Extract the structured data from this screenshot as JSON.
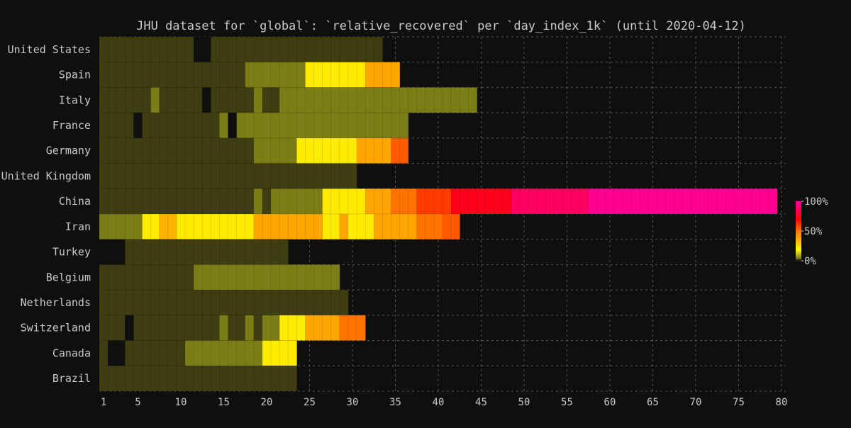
{
  "chart_data": {
    "type": "heatmap",
    "title": "JHU dataset for `global`: `relative_recovered` per `day_index_1k` (until 2020-04-12)",
    "xlabel": "",
    "ylabel": "",
    "xlim": [
      1,
      80
    ],
    "x_ticks": [
      1,
      5,
      10,
      15,
      20,
      25,
      30,
      35,
      40,
      45,
      50,
      55,
      60,
      65,
      70,
      75,
      80
    ],
    "grid": true,
    "colorbar": {
      "ticks": [
        "100%",
        "50%",
        "0%"
      ],
      "stops": [
        "#3a3a12",
        "#6e6e16",
        "#9a9a1a",
        "#ffff00",
        "#ffc400",
        "#ff9900",
        "#ff5a00",
        "#ff0000",
        "#ff00a0"
      ]
    },
    "note": "Rows list countries; each row gives [start_day, end_day, relative_recovered_percent] runs estimated from cell colors.",
    "rows": [
      {
        "name": "United States",
        "segments": [
          [
            1,
            11,
            0.3
          ],
          [
            12,
            13,
            0
          ],
          [
            14,
            33,
            0.3
          ]
        ]
      },
      {
        "name": "Spain",
        "segments": [
          [
            1,
            17,
            0.3
          ],
          [
            18,
            24,
            3
          ],
          [
            25,
            31,
            22
          ],
          [
            32,
            35,
            38
          ]
        ]
      },
      {
        "name": "Italy",
        "segments": [
          [
            1,
            6,
            0.3
          ],
          [
            7,
            7,
            3
          ],
          [
            8,
            12,
            0.3
          ],
          [
            13,
            13,
            0
          ],
          [
            14,
            18,
            0.3
          ],
          [
            19,
            19,
            3
          ],
          [
            20,
            21,
            0.3
          ],
          [
            22,
            44,
            3
          ]
        ]
      },
      {
        "name": "France",
        "segments": [
          [
            1,
            4,
            0.3
          ],
          [
            5,
            5,
            0
          ],
          [
            6,
            14,
            0.3
          ],
          [
            15,
            15,
            3
          ],
          [
            16,
            16,
            0
          ],
          [
            17,
            36,
            3
          ]
        ]
      },
      {
        "name": "Germany",
        "segments": [
          [
            1,
            18,
            0.3
          ],
          [
            19,
            23,
            3
          ],
          [
            24,
            30,
            22
          ],
          [
            31,
            34,
            38
          ],
          [
            35,
            36,
            55
          ]
        ]
      },
      {
        "name": "United Kingdom",
        "segments": [
          [
            1,
            30,
            0.3
          ]
        ]
      },
      {
        "name": "China",
        "segments": [
          [
            1,
            18,
            0.3
          ],
          [
            19,
            19,
            3
          ],
          [
            20,
            20,
            0.3
          ],
          [
            21,
            26,
            3
          ],
          [
            27,
            31,
            22
          ],
          [
            32,
            34,
            38
          ],
          [
            35,
            37,
            50
          ],
          [
            38,
            41,
            60
          ],
          [
            42,
            48,
            75
          ],
          [
            49,
            57,
            88
          ],
          [
            58,
            79,
            97
          ]
        ]
      },
      {
        "name": "Iran",
        "segments": [
          [
            1,
            5,
            3
          ],
          [
            6,
            7,
            22
          ],
          [
            8,
            9,
            35
          ],
          [
            10,
            18,
            22
          ],
          [
            19,
            26,
            38
          ],
          [
            27,
            28,
            22
          ],
          [
            29,
            29,
            38
          ],
          [
            30,
            32,
            22
          ],
          [
            33,
            37,
            38
          ],
          [
            38,
            40,
            50
          ],
          [
            41,
            42,
            55
          ]
        ]
      },
      {
        "name": "Turkey",
        "segments": [
          [
            1,
            3,
            0
          ],
          [
            4,
            22,
            0.3
          ]
        ]
      },
      {
        "name": "Belgium",
        "segments": [
          [
            1,
            11,
            0.3
          ],
          [
            12,
            28,
            3
          ]
        ]
      },
      {
        "name": "Netherlands",
        "segments": [
          [
            1,
            29,
            0.3
          ]
        ]
      },
      {
        "name": "Switzerland",
        "segments": [
          [
            1,
            3,
            0.3
          ],
          [
            4,
            4,
            0
          ],
          [
            5,
            14,
            0.3
          ],
          [
            15,
            15,
            3
          ],
          [
            16,
            17,
            0.3
          ],
          [
            18,
            18,
            3
          ],
          [
            19,
            19,
            0.3
          ],
          [
            20,
            21,
            3
          ],
          [
            22,
            24,
            22
          ],
          [
            25,
            28,
            38
          ],
          [
            29,
            31,
            50
          ]
        ]
      },
      {
        "name": "Canada",
        "segments": [
          [
            1,
            1,
            0.3
          ],
          [
            2,
            3,
            0
          ],
          [
            4,
            10,
            0.3
          ],
          [
            11,
            19,
            3
          ],
          [
            20,
            23,
            22
          ]
        ]
      },
      {
        "name": "Brazil",
        "segments": [
          [
            1,
            23,
            0.3
          ]
        ]
      }
    ]
  }
}
